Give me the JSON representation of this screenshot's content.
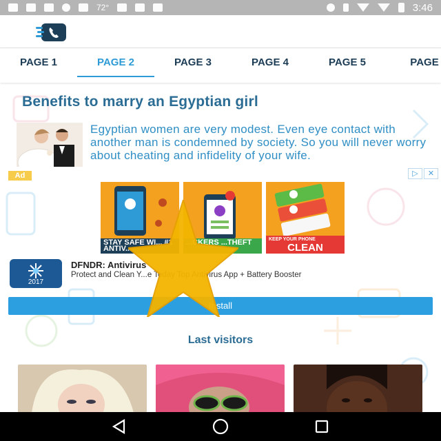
{
  "status_bar": {
    "temperature": "72°",
    "time": "3:46",
    "left_icons": [
      "facebook-icon",
      "picture-icon",
      "mail-icon",
      "alert-icon",
      "lock-icon",
      "weather-icon",
      "briefcase-icon",
      "briefcase-icon"
    ],
    "right_icons": [
      "location-icon",
      "bluetooth-icon",
      "wifi-icon",
      "signal-icon",
      "battery-icon"
    ]
  },
  "header": {
    "logo_icon": "phone-chat-icon"
  },
  "tabs": [
    {
      "label": "PAGE 1",
      "active": false
    },
    {
      "label": "PAGE 2",
      "active": true
    },
    {
      "label": "PAGE 3",
      "active": false
    },
    {
      "label": "PAGE 4",
      "active": false
    },
    {
      "label": "PAGE 5",
      "active": false
    },
    {
      "label": "PAGE",
      "active": false
    }
  ],
  "article": {
    "title": "Benefits to marry an Egyptian girl",
    "text": "Egyptian women are very modest. Even eye contact with another man is condemned by society. So you will never worry about cheating and infidelity of your wife."
  },
  "ad": {
    "badge": "Ad",
    "choices": [
      "▷",
      "✕"
    ],
    "panels": [
      {
        "caption": "STAY SAFE WI... #1 ANTIV..."
      },
      {
        "caption": "...CKERS ...THEFT"
      },
      {
        "caption_small": "KEEP YOUR PHONE",
        "caption": "CLEAN"
      }
    ],
    "app_icon_year": "2017",
    "app_name": "DFNDR: Antivirus",
    "app_desc": "Protect and Clean Y...e Today Top Antivirus App + Battery Booster",
    "install_label": "Install"
  },
  "visitors": {
    "title": "Last visitors",
    "count": 3
  },
  "nav": {
    "buttons": [
      "back-icon",
      "home-icon",
      "recents-icon"
    ]
  },
  "colors": {
    "accent": "#2f9bd6",
    "title": "#2a6c94",
    "install": "#2b9fe0",
    "star": "#f4b400"
  }
}
